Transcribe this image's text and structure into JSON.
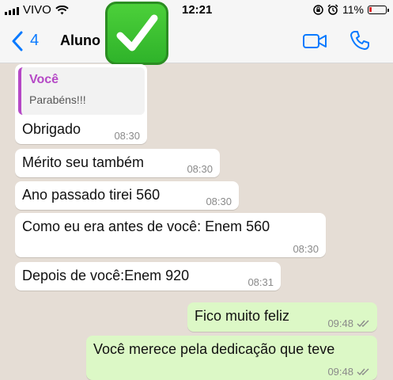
{
  "status_bar": {
    "carrier": "VIVO",
    "time": "12:21",
    "battery": "11%"
  },
  "header": {
    "back_count": "4",
    "contact_name": "Aluno",
    "emoji_icon": "check-mark-button-icon"
  },
  "messages": [
    {
      "quote_author": "Você",
      "quote_text": "Parabéns!!!",
      "text": "Obrigado",
      "time": "08:30",
      "direction": "in"
    },
    {
      "text": "Mérito seu também",
      "time": "08:30",
      "direction": "in"
    },
    {
      "text": "Ano passado tirei 560",
      "time": "08:30",
      "direction": "in"
    },
    {
      "text": "Como eu era antes de você: Enem 560",
      "time": "08:30",
      "direction": "in"
    },
    {
      "text": "Depois de você:Enem 920",
      "time": "08:31",
      "direction": "in"
    },
    {
      "text": "Fico muito feliz",
      "time": "09:48",
      "direction": "out",
      "read": true
    },
    {
      "text": "Você merece pela dedicação que teve",
      "time": "09:48",
      "direction": "out",
      "read": true
    }
  ],
  "colors": {
    "accent": "#0a7aff",
    "incoming_bubble": "#ffffff",
    "outgoing_bubble": "#dcf8c6",
    "quote_author": "#b548c6",
    "chat_background": "#e5ddd5"
  }
}
